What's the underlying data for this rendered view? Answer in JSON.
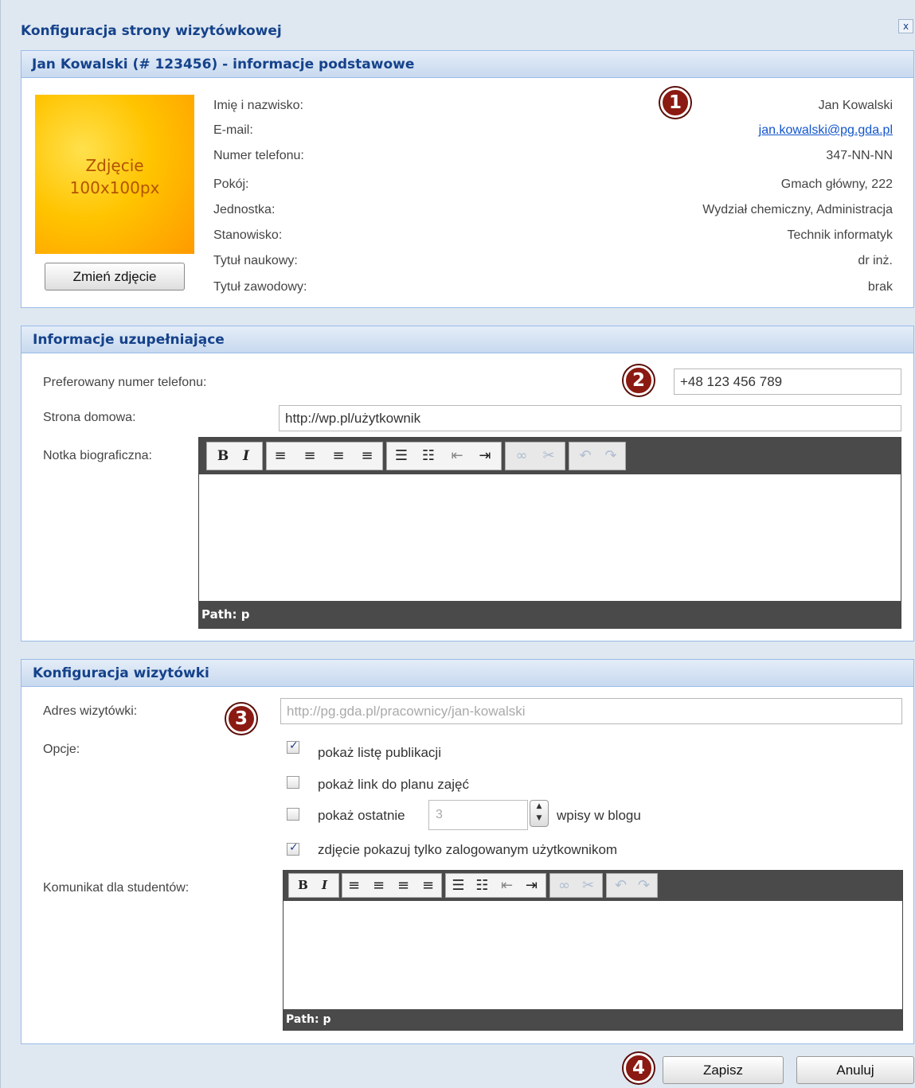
{
  "dialog": {
    "title": "Konfiguracja strony wizytówkowej",
    "close_label": "x"
  },
  "basic": {
    "header": "Jan Kowalski (# 123456) - informacje podstawowe",
    "photo_text_line1": "Zdjęcie",
    "photo_text_line2": "100x100px",
    "change_photo_label": "Zmień zdjęcie",
    "rows": [
      {
        "label": "Imię i nazwisko:",
        "value": "Jan Kowalski"
      },
      {
        "label": "E-mail:",
        "value": "jan.kowalski@pg.gda.pl"
      },
      {
        "label": "Numer telefonu:",
        "value": "347-NN-NN"
      },
      {
        "label": "Pokój:",
        "value": "Gmach główny, 222"
      },
      {
        "label": "Jednostka:",
        "value": "Wydział chemiczny, Administracja"
      },
      {
        "label": "Stanowisko:",
        "value": "Technik informatyk"
      },
      {
        "label": "Tytuł naukowy:",
        "value": "dr inż."
      },
      {
        "label": "Tytuł zawodowy:",
        "value": "brak"
      }
    ]
  },
  "extra": {
    "header": "Informacje uzupełniające",
    "phone_label": "Preferowany numer telefonu:",
    "phone_value": "+48 123 456 789",
    "homepage_label": "Strona domowa:",
    "homepage_value": "http://wp.pl/użytkownik",
    "bio_label": "Notka biograficzna:",
    "bio_path": "Path: p"
  },
  "card": {
    "header": "Konfiguracja wizytówki",
    "address_label": "Adres wizytówki:",
    "address_value": "http://pg.gda.pl/pracownicy/jan-kowalski",
    "options_label": "Opcje:",
    "options": [
      {
        "label": "pokaż listę publikacji",
        "checked": true
      },
      {
        "label": "pokaż link do planu zajęć",
        "checked": false
      },
      {
        "label": "pokaż ostatnie",
        "checked": false
      },
      {
        "label": "zdjęcie pokazuj tylko zalogowanym użytkownikom",
        "checked": true
      }
    ],
    "recent_count": "3",
    "recent_suffix": "wpisy w blogu",
    "message_label": "Komunikat dla studentów:",
    "message_path": "Path: p"
  },
  "badges": [
    "1",
    "2",
    "3",
    "4"
  ],
  "footer": {
    "save_label": "Zapisz",
    "cancel_label": "Anuluj"
  },
  "colors": {
    "header_text": "#15428b",
    "badge": "#8b1a12",
    "link": "#1155cc",
    "toolbar_dark": "#4a4a4a"
  }
}
